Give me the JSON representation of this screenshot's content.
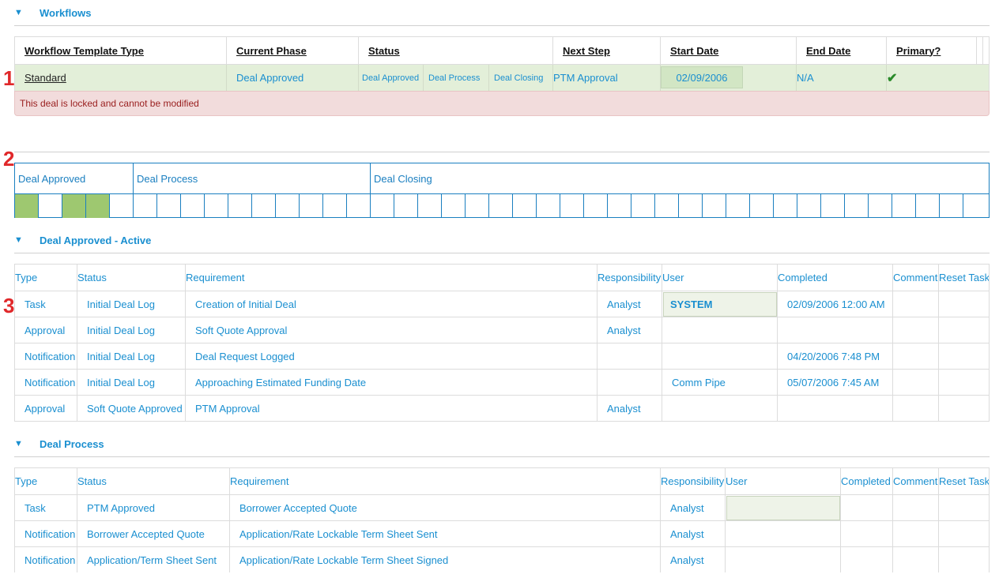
{
  "workflows_section": {
    "title": "Workflows"
  },
  "markers": [
    "1",
    "2",
    "3"
  ],
  "workflow_table": {
    "headers": [
      "Workflow Template Type",
      "Current Phase",
      "Status",
      "Next Step",
      "Start Date",
      "End Date",
      "Primary?"
    ],
    "row": {
      "template_type": "Standard",
      "current_phase": "Deal Approved",
      "status_phases": [
        "Deal Approved",
        "Deal Process",
        "Deal Closing"
      ],
      "next_step": "PTM Approval",
      "start_date": "02/09/2006",
      "end_date": "N/A",
      "primary": "✔"
    },
    "locked_message": "This deal is locked and cannot be modified"
  },
  "tracker": {
    "phases": [
      "Deal Approved",
      "Deal Process",
      "Deal Closing"
    ],
    "total_cells": 41,
    "completed_cells": [
      0,
      2,
      3
    ]
  },
  "deal_approved_section": {
    "title": "Deal Approved - Active",
    "headers": [
      "Type",
      "Status",
      "Requirement",
      "Responsibility",
      "User",
      "Completed",
      "Comment",
      "Reset Task"
    ],
    "rows": [
      {
        "type": "Task",
        "status": "Initial Deal Log",
        "requirement": "Creation of Initial Deal",
        "responsibility": "Analyst",
        "user": "SYSTEM",
        "completed": "02/09/2006 12:00 AM"
      },
      {
        "type": "Approval",
        "status": "Initial Deal Log",
        "requirement": "Soft Quote Approval",
        "responsibility": "Analyst",
        "user": "",
        "completed": ""
      },
      {
        "type": "Notification",
        "status": "Initial Deal Log",
        "requirement": "Deal Request Logged",
        "responsibility": "",
        "user": "",
        "completed": "04/20/2006 7:48 PM"
      },
      {
        "type": "Notification",
        "status": "Initial Deal Log",
        "requirement": "Approaching Estimated Funding Date",
        "responsibility": "",
        "user": "Comm Pipe",
        "completed": "05/07/2006 7:45 AM"
      },
      {
        "type": "Approval",
        "status": "Soft Quote Approved",
        "requirement": "PTM Approval",
        "responsibility": "Analyst",
        "user": "",
        "completed": ""
      }
    ]
  },
  "deal_process_section": {
    "title": "Deal Process",
    "headers": [
      "Type",
      "Status",
      "Requirement",
      "Responsibility",
      "User",
      "Completed",
      "Comment",
      "Reset Task"
    ],
    "rows": [
      {
        "type": "Task",
        "status": "PTM Approved",
        "requirement": "Borrower Accepted Quote",
        "responsibility": "Analyst",
        "user": "",
        "completed": ""
      },
      {
        "type": "Notification",
        "status": "Borrower Accepted Quote",
        "requirement": "Application/Rate Lockable Term Sheet Sent",
        "responsibility": "Analyst",
        "user": "",
        "completed": ""
      },
      {
        "type": "Notification",
        "status": "Application/Term Sheet Sent",
        "requirement": "Application/Rate Lockable Term Sheet Signed",
        "responsibility": "Analyst",
        "user": "",
        "completed": ""
      }
    ]
  },
  "colors": {
    "link": "#1a8fd0",
    "marker": "#e0282a",
    "row_highlight": "#e3efd9",
    "locked_bg": "#f2dcdc",
    "tracker_done": "#9ec870"
  },
  "icons": {
    "collapse": "triangle-down-icon",
    "primary": "checkmark-icon"
  }
}
